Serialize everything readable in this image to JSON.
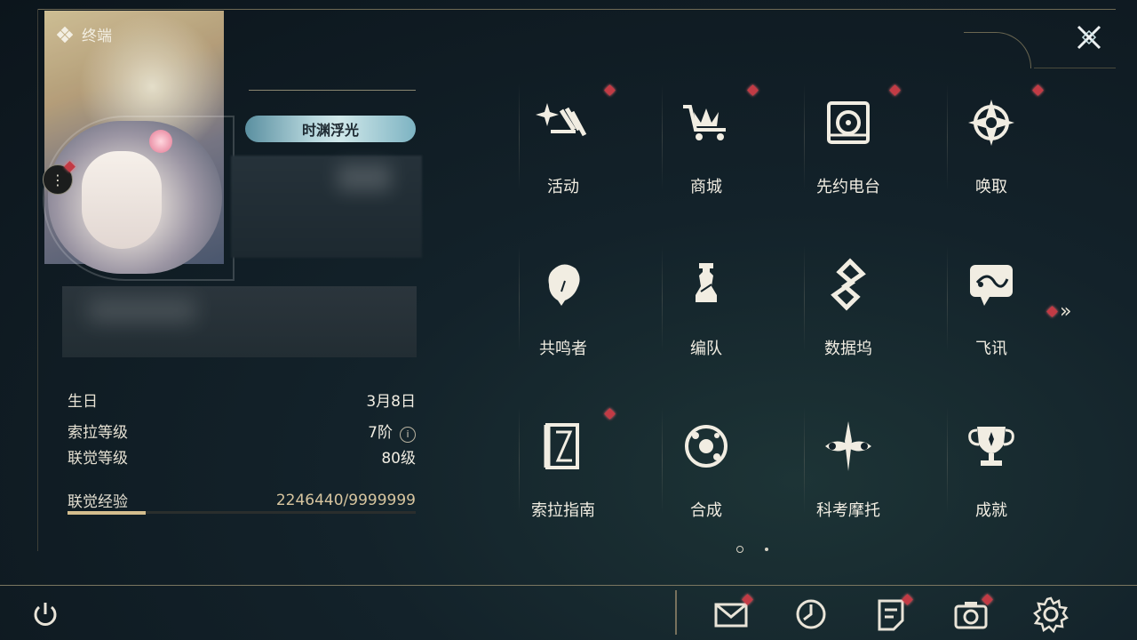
{
  "header": {
    "terminal_label": "终端"
  },
  "profile": {
    "title_badge": "时渊浮光",
    "info": [
      {
        "label": "生日",
        "value": "3月8日"
      },
      {
        "label": "索拉等级",
        "value": "7阶"
      },
      {
        "label": "联觉等级",
        "value": "80级"
      }
    ],
    "exp": {
      "label": "联觉经验",
      "value": "2246440/9999999",
      "progress": 0.2246
    }
  },
  "menu": [
    {
      "label": "活动",
      "icon": "sparkle-icon",
      "badge": true
    },
    {
      "label": "商城",
      "icon": "crown-cart-icon",
      "badge": true
    },
    {
      "label": "先约电台",
      "icon": "radio-icon",
      "badge": true
    },
    {
      "label": "唤取",
      "icon": "compass-icon",
      "badge": true
    },
    {
      "label": "共鸣者",
      "icon": "character-head-icon",
      "badge": false
    },
    {
      "label": "编队",
      "icon": "chess-piece-icon",
      "badge": false
    },
    {
      "label": "数据坞",
      "icon": "data-dock-icon",
      "badge": false
    },
    {
      "label": "飞讯",
      "icon": "chat-bubble-icon",
      "badge": false
    },
    {
      "label": "索拉指南",
      "icon": "guide-book-icon",
      "badge": true
    },
    {
      "label": "合成",
      "icon": "synthesis-icon",
      "badge": false
    },
    {
      "label": "科考摩托",
      "icon": "motorbike-icon",
      "badge": false
    },
    {
      "label": "成就",
      "icon": "trophy-icon",
      "badge": false
    }
  ],
  "pagination": {
    "current": 1,
    "total": 2
  },
  "bottom_bar": [
    {
      "icon": "mail-icon",
      "badge": true
    },
    {
      "icon": "clock-icon",
      "badge": false
    },
    {
      "icon": "notice-icon",
      "badge": true
    },
    {
      "icon": "camera-icon",
      "badge": true
    },
    {
      "icon": "settings-gear-icon",
      "badge": false
    }
  ],
  "colors": {
    "accent_red": "#c23b45",
    "exp_bar": "#d4bd8e",
    "text": "#f1ede2"
  }
}
